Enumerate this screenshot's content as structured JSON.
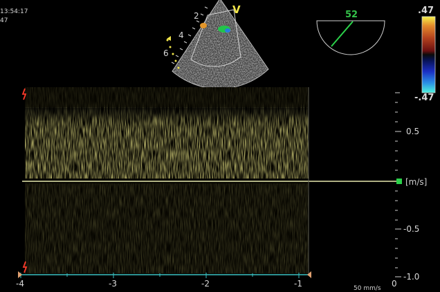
{
  "header": {
    "time": "13:54:17",
    "frame_index": "47"
  },
  "sector": {
    "mode_letter": "V",
    "depth_labels": [
      "2",
      "4",
      "6"
    ]
  },
  "angle_gauge": {
    "angle_value": "52"
  },
  "color_bar": {
    "top_value": ".47",
    "bottom_value": "-.47",
    "colors": [
      "#f5f24a",
      "#e38a2c",
      "#b4421e",
      "#6a0f10",
      "#0b0b0b",
      "#06104a",
      "#1b2fc4",
      "#2a8fe6",
      "#4cf2dd"
    ]
  },
  "spectrum": {
    "velocity_unit": "[m/s]",
    "y_ticks": [
      "0.5",
      "-0.5",
      "-1.0"
    ],
    "x_ticks": [
      "-4",
      "-3",
      "-2",
      "-1",
      "0"
    ],
    "sweep_speed": "50 mm/s",
    "colors": {
      "doppler": "#f2e64a",
      "baseline": "#e9ebb0",
      "time_axis": "#3ac2c2",
      "marker": "#ff3a2a",
      "cursor": "#2bd14a"
    }
  }
}
